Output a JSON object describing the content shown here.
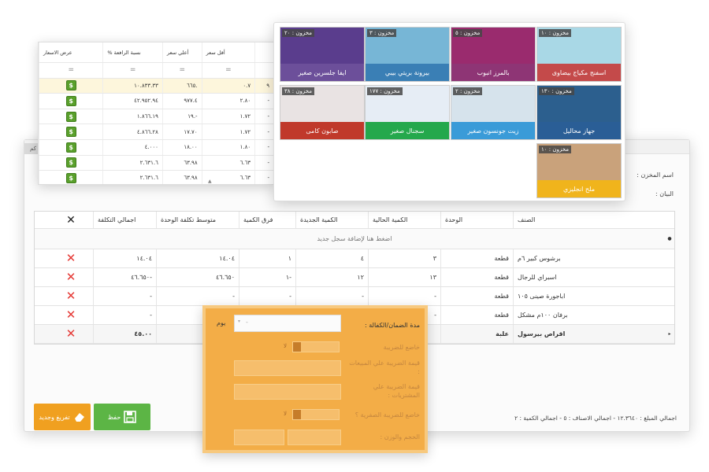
{
  "main_window": {
    "tab_stub": "كم",
    "store_label": "اسم المخزن :",
    "statement_label": "البيان :",
    "columns": {
      "name": "الصنف",
      "unit": "الوحدة",
      "current_qty": "الكمية الحالية",
      "new_qty": "الكمية الجديدة",
      "qty_diff": "فرق الكمية",
      "avg_cost": "متوسط تكلفة الوحدة",
      "total_cost": "اجمالي التكلفة"
    },
    "new_row_text": "اضغط هنا لإضافة سجل جديد",
    "rows": [
      {
        "name": "برشوس كبير ٦م",
        "unit": "قطعة",
        "current": "٣",
        "new": "٤",
        "diff": "١",
        "avg": "١٤.٠٤",
        "total": "١٤.٠٤"
      },
      {
        "name": "اسبراي للرجال",
        "unit": "قطعة",
        "current": "١٣",
        "new": "١٢",
        "diff": "١-",
        "avg": "٤٦.٦٥٠",
        "total": "٤٦.٦٥٠-"
      },
      {
        "name": "اباجورة صينى ١٠٥",
        "unit": "قطعة",
        "current": "-",
        "new": "-",
        "diff": "-",
        "avg": "-",
        "total": "-"
      },
      {
        "name": "برفان ١٠٠م مشكل",
        "unit": "قطعة",
        "current": "-",
        "new": "-",
        "diff": "-",
        "avg": "-",
        "total": "-"
      },
      {
        "name": "اقراص بيرسول",
        "unit": "علبة",
        "current": "",
        "new": "",
        "diff": "",
        "avg": "٢٢.٥٠",
        "total": "٤٥.٠٠"
      }
    ],
    "save_label": "حفظ",
    "clear_label": "تفريغ وجديد",
    "totals": "اجمالي المبلغ : ١٢.٣٦٤٠ - اجمالي الاصناف : ٥ - اجمالي الكمية : ٢"
  },
  "price_window": {
    "columns": [
      "أقل سعر",
      "أعلي سعر",
      "نسبة الرافعة %",
      "عرض الاسعار"
    ],
    "filter_symbol": "=",
    "rows": [
      {
        "a": "٩",
        "low": "٠.٧",
        "high": "٦٦٥.",
        "pct": "١٠.٨٣٣.٣٣"
      },
      {
        "a": "-",
        "low": "٢.٨٠",
        "high": "٩٧٧.٤",
        "pct": "٤٢.٩٥٢.٩٤"
      },
      {
        "a": "-",
        "low": "١.٧٢",
        "high": "١٩.-",
        "pct": "١.٨٦٦.١٩"
      },
      {
        "a": "-",
        "low": "١.٧٢",
        "high": "١٧.٧٠",
        "pct": "٤.٨٦٦.٢٨"
      },
      {
        "a": "-",
        "low": "١.٨٠",
        "high": "١٨.٠٠",
        "pct": "٤.٠٠٠"
      },
      {
        "a": "-",
        "low": "٦.٦٣",
        "high": "٦٣.٩٨",
        "pct": "٢.٦٣١.٦"
      },
      {
        "a": "-",
        "low": "٦.٦٣",
        "high": "٦٣.٩٨",
        "pct": "٢.٦٣١.٦"
      }
    ]
  },
  "tiles": [
    {
      "name": "ايفا جلسرين صغير",
      "stock": "مخزون : ٢٠",
      "bar": "#6c4f9a",
      "img": "#5a3d8d"
    },
    {
      "name": "بيرونة بريتي بيبي",
      "stock": "مخزون : ٣",
      "bar": "#3a7fb5",
      "img": "#77b6d6"
    },
    {
      "name": "بالمرز انبوب",
      "stock": "مخزون : ٥",
      "bar": "#8e3575",
      "img": "#9a2b6e"
    },
    {
      "name": "اسفنج مكياج بيضاوى",
      "stock": "مخزون : ١٠",
      "bar": "#c44a4a",
      "img": "#a9d8e6"
    },
    {
      "name": "صابون كامى",
      "stock": "مخزون : ٣٨",
      "bar": "#c0392b",
      "img": "#e9e3e3"
    },
    {
      "name": "سجنال صغير",
      "stock": "مخزون : ١٧٧",
      "bar": "#24a84c",
      "img": "#e6edf5"
    },
    {
      "name": "زيت جونسون صغير",
      "stock": "مخزون : ٢",
      "bar": "#3a9bd8",
      "img": "#d6e3ec"
    },
    {
      "name": "جهاز محاليل",
      "stock": "مخزون : ١٣٠",
      "bar": "#2a5e96",
      "img": "#2c5f8e"
    },
    {
      "name": "ملح انجليزي",
      "stock": "مخزون : ١٠",
      "bar": "#f0b41c",
      "img": "#c9a27b"
    }
  ],
  "orange_form": {
    "warranty_label": "مدة الضمان/الكفالة :",
    "warranty_unit": "يوم",
    "warranty_value": "-",
    "taxable_label": "خاضع للضريبة",
    "sales_tax_label": "قيمة الضريبة علي المبيعات :",
    "purchase_tax_label": "قيمة الضريبة علي المشتريات :",
    "zero_tax_label": "خاضع للضريبة الصفرية ؟",
    "volume_label": "الحجم والوزن :",
    "toggle_text": "لا"
  }
}
